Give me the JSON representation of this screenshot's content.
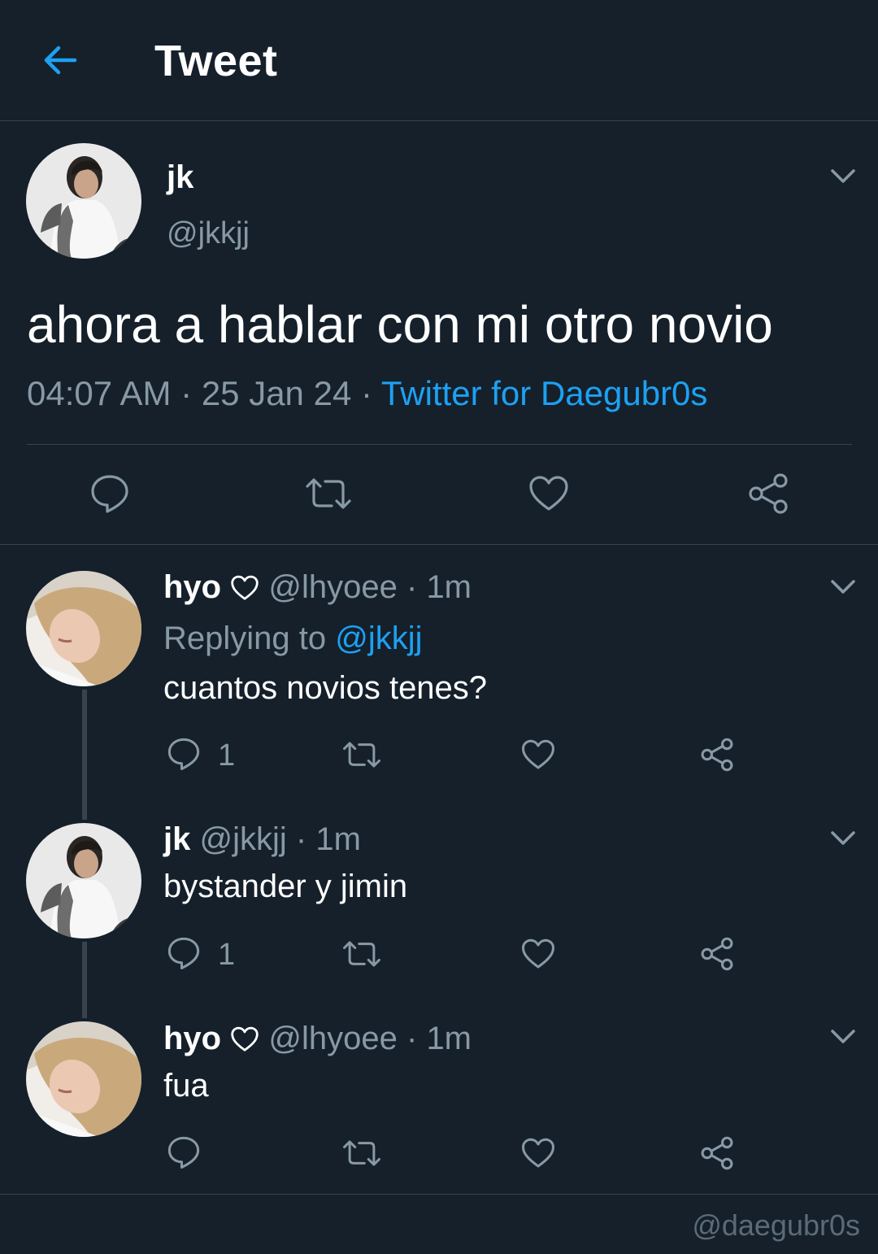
{
  "header": {
    "title": "Tweet",
    "back_icon": "arrow-left-icon"
  },
  "colors": {
    "background": "#15202b",
    "accent": "#1da1f2",
    "muted": "#8899a6",
    "divider": "#38444d"
  },
  "main_tweet": {
    "name": "jk",
    "handle": "@jkkjj",
    "text": "ahora a hablar con mi otro novio",
    "time": "04:07 AM",
    "sep1": "·",
    "date": "25 Jan 24",
    "sep2": "·",
    "source": "Twitter for Daegubr0s",
    "actions": [
      "reply-icon",
      "retweet-icon",
      "like-icon",
      "share-icon"
    ]
  },
  "replies": [
    {
      "name": "hyo",
      "name_icon": "heart-outline-icon",
      "handle": "@lhyoee",
      "sep": "·",
      "age": "1m",
      "replying_prefix": "Replying to",
      "replying_handle": "@jkkjj",
      "text": "cuantos novios tenes?",
      "reply_count": "1"
    },
    {
      "name": "jk",
      "handle": "@jkkjj",
      "sep": "·",
      "age": "1m",
      "text": "bystander y jimin",
      "reply_count": "1"
    },
    {
      "name": "hyo",
      "name_icon": "heart-outline-icon",
      "handle": "@lhyoee",
      "sep": "·",
      "age": "1m",
      "text": "fua",
      "reply_count": ""
    }
  ],
  "watermark": "@daegubr0s"
}
